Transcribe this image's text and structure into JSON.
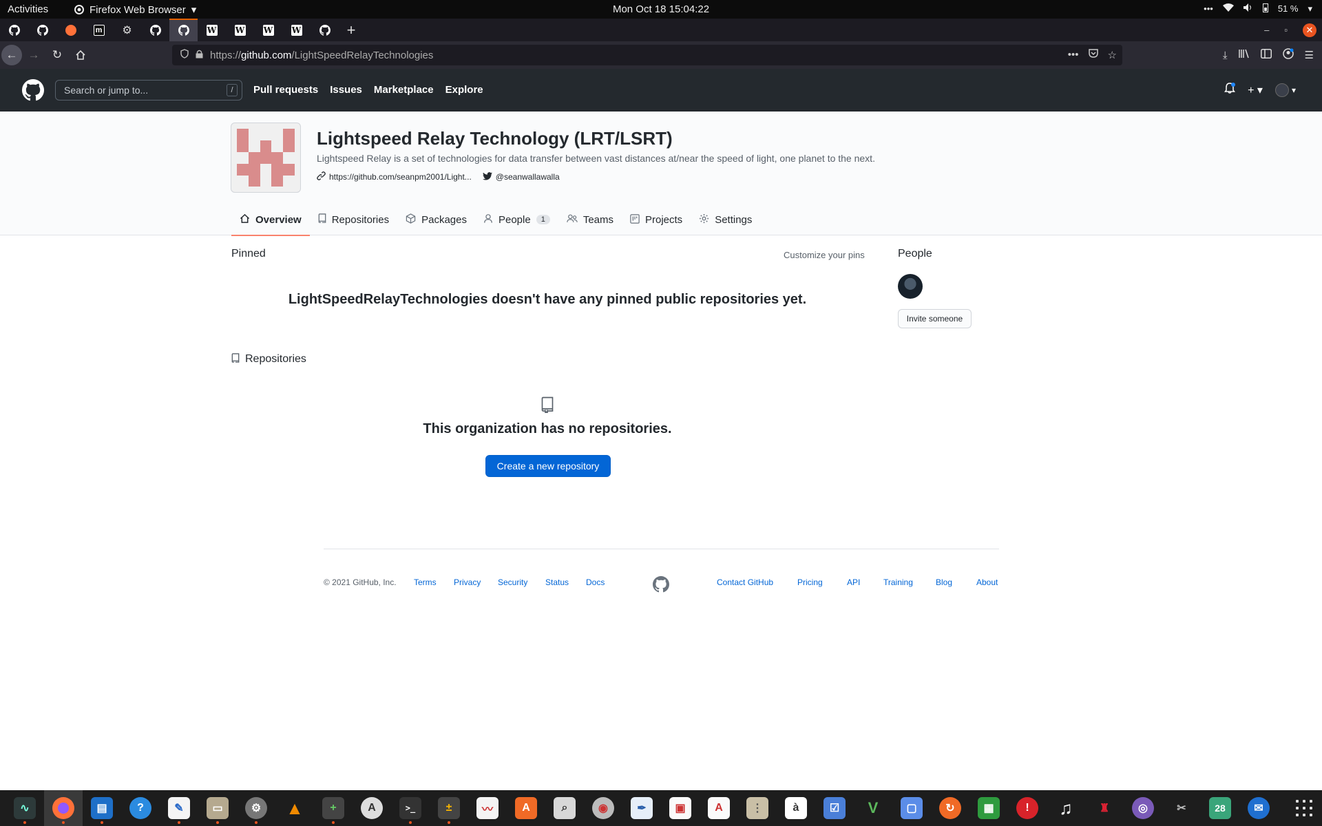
{
  "system": {
    "activities": "Activities",
    "app_name": "Firefox Web Browser",
    "clock": "Mon Oct 18  15:04:22",
    "battery": "51 %"
  },
  "browser": {
    "url_prefix": "https://",
    "url_host": "github.com",
    "url_path": "/LightSpeedRelayTechnologies",
    "tabs": [
      "github",
      "github",
      "firefox",
      "m",
      "settings",
      "github",
      "github",
      "wikipedia",
      "wikipedia",
      "wikipedia",
      "wikipedia",
      "github"
    ]
  },
  "github": {
    "search_placeholder": "Search or jump to...",
    "search_key": "/",
    "nav": [
      "Pull requests",
      "Issues",
      "Marketplace",
      "Explore"
    ]
  },
  "org": {
    "title": "Lightspeed Relay Technology (LRT/LSRT)",
    "description": "Lightspeed Relay is a set of technologies for data transfer between vast distances at/near the speed of light, one planet to the next.",
    "website": "https://github.com/seanpm2001/Light...",
    "twitter": "@seanwallawalla",
    "tabs": {
      "overview": "Overview",
      "repositories": "Repositories",
      "packages": "Packages",
      "people": "People",
      "people_count": "1",
      "teams": "Teams",
      "projects": "Projects",
      "settings": "Settings"
    }
  },
  "main": {
    "pinned_label": "Pinned",
    "customize_pins": "Customize your pins",
    "no_pinned": "LightSpeedRelayTechnologies doesn't have any pinned public repositories yet.",
    "repositories_label": "Repositories",
    "no_repos": "This organization has no repositories.",
    "create_repo": "Create a new repository",
    "people_label": "People",
    "invite": "Invite someone"
  },
  "footer": {
    "copyright": "© 2021 GitHub, Inc.",
    "left_links": [
      "Terms",
      "Privacy",
      "Security",
      "Status",
      "Docs"
    ],
    "right_links": [
      "Contact GitHub",
      "Pricing",
      "API",
      "Training",
      "Blog",
      "About"
    ]
  },
  "dock": {
    "calendar_day": "28"
  },
  "colors": {
    "accent_blue": "#0366d6",
    "tab_underline": "#f9826c",
    "github_header": "#24292e",
    "ubuntu_orange": "#e95420"
  }
}
